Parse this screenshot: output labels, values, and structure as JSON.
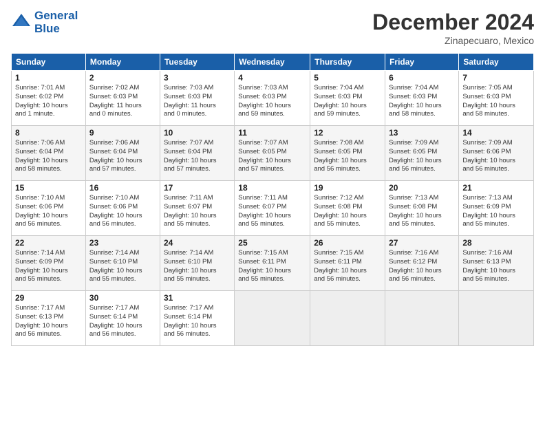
{
  "header": {
    "logo_line1": "General",
    "logo_line2": "Blue",
    "main_title": "December 2024",
    "subtitle": "Zinapecuaro, Mexico"
  },
  "weekdays": [
    "Sunday",
    "Monday",
    "Tuesday",
    "Wednesday",
    "Thursday",
    "Friday",
    "Saturday"
  ],
  "weeks": [
    [
      {
        "day": "1",
        "sunrise": "7:01 AM",
        "sunset": "6:02 PM",
        "daylight": "10 hours and 1 minute."
      },
      {
        "day": "2",
        "sunrise": "7:02 AM",
        "sunset": "6:03 PM",
        "daylight": "11 hours and 0 minutes."
      },
      {
        "day": "3",
        "sunrise": "7:03 AM",
        "sunset": "6:03 PM",
        "daylight": "11 hours and 0 minutes."
      },
      {
        "day": "4",
        "sunrise": "7:03 AM",
        "sunset": "6:03 PM",
        "daylight": "10 hours and 59 minutes."
      },
      {
        "day": "5",
        "sunrise": "7:04 AM",
        "sunset": "6:03 PM",
        "daylight": "10 hours and 59 minutes."
      },
      {
        "day": "6",
        "sunrise": "7:04 AM",
        "sunset": "6:03 PM",
        "daylight": "10 hours and 58 minutes."
      },
      {
        "day": "7",
        "sunrise": "7:05 AM",
        "sunset": "6:03 PM",
        "daylight": "10 hours and 58 minutes."
      }
    ],
    [
      {
        "day": "8",
        "sunrise": "7:06 AM",
        "sunset": "6:04 PM",
        "daylight": "10 hours and 58 minutes."
      },
      {
        "day": "9",
        "sunrise": "7:06 AM",
        "sunset": "6:04 PM",
        "daylight": "10 hours and 57 minutes."
      },
      {
        "day": "10",
        "sunrise": "7:07 AM",
        "sunset": "6:04 PM",
        "daylight": "10 hours and 57 minutes."
      },
      {
        "day": "11",
        "sunrise": "7:07 AM",
        "sunset": "6:05 PM",
        "daylight": "10 hours and 57 minutes."
      },
      {
        "day": "12",
        "sunrise": "7:08 AM",
        "sunset": "6:05 PM",
        "daylight": "10 hours and 56 minutes."
      },
      {
        "day": "13",
        "sunrise": "7:09 AM",
        "sunset": "6:05 PM",
        "daylight": "10 hours and 56 minutes."
      },
      {
        "day": "14",
        "sunrise": "7:09 AM",
        "sunset": "6:06 PM",
        "daylight": "10 hours and 56 minutes."
      }
    ],
    [
      {
        "day": "15",
        "sunrise": "7:10 AM",
        "sunset": "6:06 PM",
        "daylight": "10 hours and 56 minutes."
      },
      {
        "day": "16",
        "sunrise": "7:10 AM",
        "sunset": "6:06 PM",
        "daylight": "10 hours and 56 minutes."
      },
      {
        "day": "17",
        "sunrise": "7:11 AM",
        "sunset": "6:07 PM",
        "daylight": "10 hours and 55 minutes."
      },
      {
        "day": "18",
        "sunrise": "7:11 AM",
        "sunset": "6:07 PM",
        "daylight": "10 hours and 55 minutes."
      },
      {
        "day": "19",
        "sunrise": "7:12 AM",
        "sunset": "6:08 PM",
        "daylight": "10 hours and 55 minutes."
      },
      {
        "day": "20",
        "sunrise": "7:13 AM",
        "sunset": "6:08 PM",
        "daylight": "10 hours and 55 minutes."
      },
      {
        "day": "21",
        "sunrise": "7:13 AM",
        "sunset": "6:09 PM",
        "daylight": "10 hours and 55 minutes."
      }
    ],
    [
      {
        "day": "22",
        "sunrise": "7:14 AM",
        "sunset": "6:09 PM",
        "daylight": "10 hours and 55 minutes."
      },
      {
        "day": "23",
        "sunrise": "7:14 AM",
        "sunset": "6:10 PM",
        "daylight": "10 hours and 55 minutes."
      },
      {
        "day": "24",
        "sunrise": "7:14 AM",
        "sunset": "6:10 PM",
        "daylight": "10 hours and 55 minutes."
      },
      {
        "day": "25",
        "sunrise": "7:15 AM",
        "sunset": "6:11 PM",
        "daylight": "10 hours and 55 minutes."
      },
      {
        "day": "26",
        "sunrise": "7:15 AM",
        "sunset": "6:11 PM",
        "daylight": "10 hours and 56 minutes."
      },
      {
        "day": "27",
        "sunrise": "7:16 AM",
        "sunset": "6:12 PM",
        "daylight": "10 hours and 56 minutes."
      },
      {
        "day": "28",
        "sunrise": "7:16 AM",
        "sunset": "6:13 PM",
        "daylight": "10 hours and 56 minutes."
      }
    ],
    [
      {
        "day": "29",
        "sunrise": "7:17 AM",
        "sunset": "6:13 PM",
        "daylight": "10 hours and 56 minutes."
      },
      {
        "day": "30",
        "sunrise": "7:17 AM",
        "sunset": "6:14 PM",
        "daylight": "10 hours and 56 minutes."
      },
      {
        "day": "31",
        "sunrise": "7:17 AM",
        "sunset": "6:14 PM",
        "daylight": "10 hours and 56 minutes."
      },
      null,
      null,
      null,
      null
    ]
  ]
}
